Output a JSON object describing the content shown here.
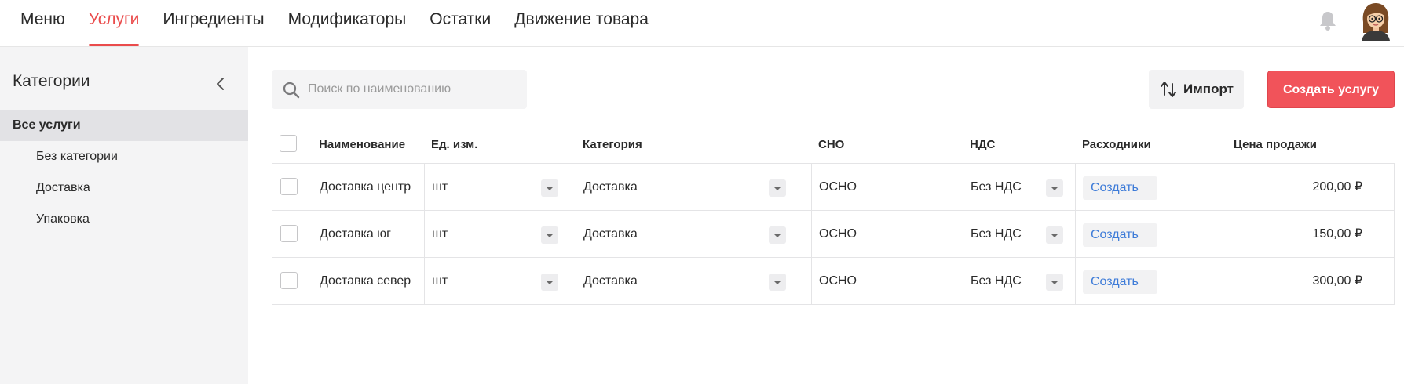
{
  "nav": {
    "tabs": [
      "Меню",
      "Услуги",
      "Ингредиенты",
      "Модификаторы",
      "Остатки",
      "Движение товара"
    ],
    "active_tab": 1
  },
  "icons": {
    "bell": "bell-icon",
    "avatar": "user-avatar",
    "collapse": "chevron-left-icon",
    "search": "search-icon",
    "import": "sort-arrows-icon",
    "dropdown": "caret-down-icon"
  },
  "colors": {
    "accent": "#ea4c4c",
    "create_button": "#f1535a",
    "link": "#3d7bd8"
  },
  "sidebar": {
    "title": "Категории",
    "items": [
      {
        "label": "Все услуги",
        "active": true
      },
      {
        "label": "Без категории"
      },
      {
        "label": "Доставка"
      },
      {
        "label": "Упаковка"
      }
    ]
  },
  "toolbar": {
    "search_placeholder": "Поиск по наименованию",
    "import_label": "Импорт",
    "create_label": "Создать услугу"
  },
  "table": {
    "columns": [
      "Наименование",
      "Ед. изм.",
      "Категория",
      "СНО",
      "НДС",
      "Расходники",
      "Цена продажи"
    ],
    "rows": [
      {
        "name": "Доставка центр",
        "unit": "шт",
        "category": "Доставка",
        "sno": "ОСНО",
        "vat": "Без НДС",
        "consumables": "Создать",
        "price": "200,00 ₽"
      },
      {
        "name": "Доставка юг",
        "unit": "шт",
        "category": "Доставка",
        "sno": "ОСНО",
        "vat": "Без НДС",
        "consumables": "Создать",
        "price": "150,00 ₽"
      },
      {
        "name": "Доставка север",
        "unit": "шт",
        "category": "Доставка",
        "sno": "ОСНО",
        "vat": "Без НДС",
        "consumables": "Создать",
        "price": "300,00 ₽"
      }
    ]
  }
}
